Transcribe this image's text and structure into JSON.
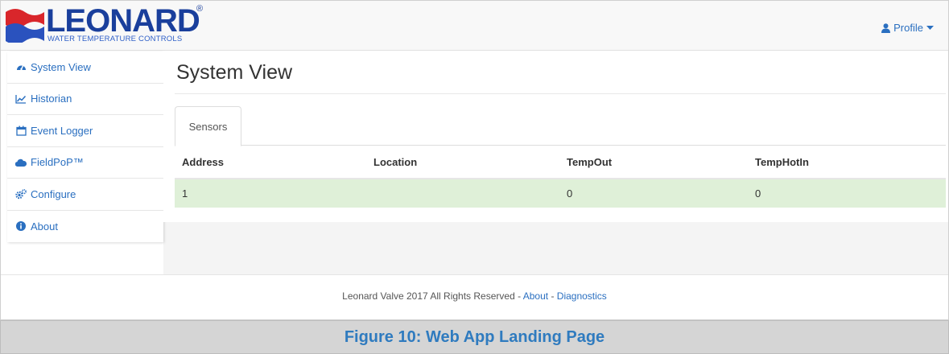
{
  "header": {
    "logo_text": "LEONARD",
    "logo_subtitle": "WATER TEMPERATURE CONTROLS",
    "logo_registered": "®",
    "profile_label": "Profile",
    "colors": {
      "logo_blue": "#1a3f9c",
      "logo_red": "#d9262b",
      "link": "#2a6fc0"
    }
  },
  "sidebar": {
    "items": [
      {
        "label": "System View",
        "icon": "dashboard-icon"
      },
      {
        "label": "Historian",
        "icon": "line-chart-icon"
      },
      {
        "label": "Event Logger",
        "icon": "calendar-icon"
      },
      {
        "label": "FieldPoP™",
        "icon": "cloud-icon"
      },
      {
        "label": "Configure",
        "icon": "cogs-icon"
      },
      {
        "label": "About",
        "icon": "info-circle-icon"
      }
    ]
  },
  "main": {
    "title": "System View",
    "tabs": [
      {
        "label": "Sensors"
      }
    ],
    "table": {
      "headers": [
        "Address",
        "Location",
        "TempOut",
        "TempHotIn"
      ],
      "rows": [
        [
          "1",
          "",
          "0",
          "0"
        ]
      ],
      "row_highlight": "#dff0d8"
    }
  },
  "footer": {
    "text": "Leonard Valve 2017 All Rights Reserved - ",
    "about_link": "About",
    "separator": " - ",
    "diagnostics_link": "Diagnostics"
  },
  "caption": {
    "text": "Figure 10: Web App Landing Page",
    "color": "#2f7bbf"
  }
}
